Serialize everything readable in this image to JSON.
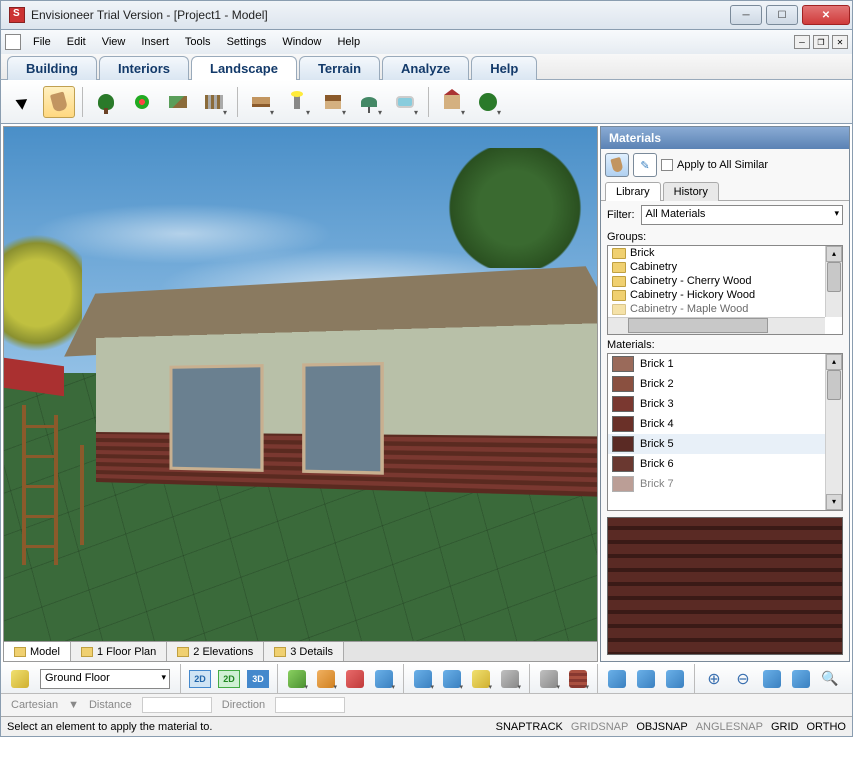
{
  "title": "Envisioneer Trial Version - [Project1 - Model]",
  "menus": [
    "File",
    "Edit",
    "View",
    "Insert",
    "Tools",
    "Settings",
    "Window",
    "Help"
  ],
  "ribbon_tabs": [
    "Building",
    "Interiors",
    "Landscape",
    "Terrain",
    "Analyze",
    "Help"
  ],
  "ribbon_active": "Landscape",
  "view_tabs": [
    {
      "label": "Model",
      "active": true
    },
    {
      "label": "1 Floor Plan"
    },
    {
      "label": "2 Elevations"
    },
    {
      "label": "3 Details"
    }
  ],
  "materials": {
    "panel_title": "Materials",
    "apply_all_label": "Apply to All Similar",
    "tabs": [
      "Library",
      "History"
    ],
    "active_tab": "Library",
    "filter_label": "Filter:",
    "filter_value": "All Materials",
    "groups_label": "Groups:",
    "groups": [
      "Brick",
      "Cabinetry",
      "Cabinetry - Cherry Wood",
      "Cabinetry - Hickory Wood",
      "Cabinetry - Maple Wood"
    ],
    "materials_label": "Materials:",
    "items": [
      "Brick 1",
      "Brick 2",
      "Brick 3",
      "Brick 4",
      "Brick 5",
      "Brick 6",
      "Brick 7"
    ],
    "selected": "Brick 5"
  },
  "location": "Ground Floor",
  "coords": {
    "mode": "Cartesian",
    "distance_label": "Distance",
    "direction_label": "Direction"
  },
  "status": {
    "message": "Select an element to apply the material to.",
    "snaps": [
      {
        "label": "SNAPTRACK",
        "on": true
      },
      {
        "label": "GRIDSNAP",
        "on": false
      },
      {
        "label": "OBJSNAP",
        "on": true
      },
      {
        "label": "ANGLESNAP",
        "on": false
      },
      {
        "label": "GRID",
        "on": true
      },
      {
        "label": "ORTHO",
        "on": true
      }
    ]
  }
}
